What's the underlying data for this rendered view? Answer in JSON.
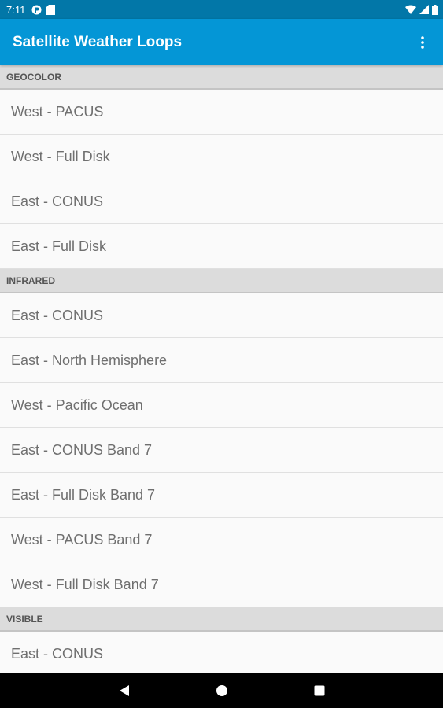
{
  "status_bar": {
    "time": "7:11",
    "icons": [
      "notification-p-icon",
      "sd-card-icon",
      "wifi-icon",
      "signal-icon",
      "battery-icon"
    ]
  },
  "app_bar": {
    "title": "Satellite Weather Loops",
    "menu_icon": "overflow-menu-icon"
  },
  "sections": [
    {
      "header": "GEOCOLOR",
      "items": [
        "West - PACUS",
        "West - Full Disk",
        "East - CONUS",
        "East - Full Disk"
      ]
    },
    {
      "header": "INFRARED",
      "items": [
        "East - CONUS",
        "East - North Hemisphere",
        "West - Pacific Ocean",
        "East - CONUS Band 7",
        "East - Full Disk Band 7",
        "West - PACUS Band 7",
        "West - Full Disk Band 7"
      ]
    },
    {
      "header": "VISIBLE",
      "items": [
        "East - CONUS"
      ]
    }
  ],
  "nav_bar": {
    "icons": [
      "back-icon",
      "home-icon",
      "recents-icon"
    ]
  },
  "colors": {
    "status_bar": "#0277a8",
    "app_bar": "#0496d6",
    "section_header": "#dcdcdc",
    "list_background": "#fafafa"
  }
}
